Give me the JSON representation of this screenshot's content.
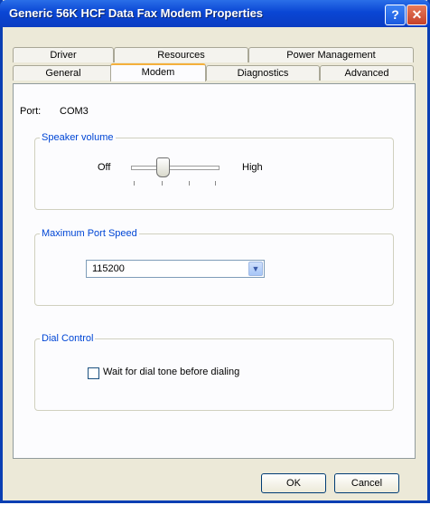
{
  "window": {
    "title": "Generic 56K HCF Data Fax Modem Properties"
  },
  "tabs": {
    "back_row": [
      "Driver",
      "Resources",
      "Power Management"
    ],
    "front_row": [
      "General",
      "Modem",
      "Diagnostics",
      "Advanced"
    ],
    "active": "Modem"
  },
  "port": {
    "label": "Port:",
    "value": "COM3"
  },
  "speaker": {
    "group_label": "Speaker volume",
    "low_label": "Off",
    "high_label": "High"
  },
  "port_speed": {
    "group_label": "Maximum Port Speed",
    "selected": "115200"
  },
  "dial": {
    "group_label": "Dial Control",
    "wait_label": "Wait for dial tone before dialing",
    "wait_checked": false
  },
  "buttons": {
    "ok": "OK",
    "cancel": "Cancel"
  }
}
